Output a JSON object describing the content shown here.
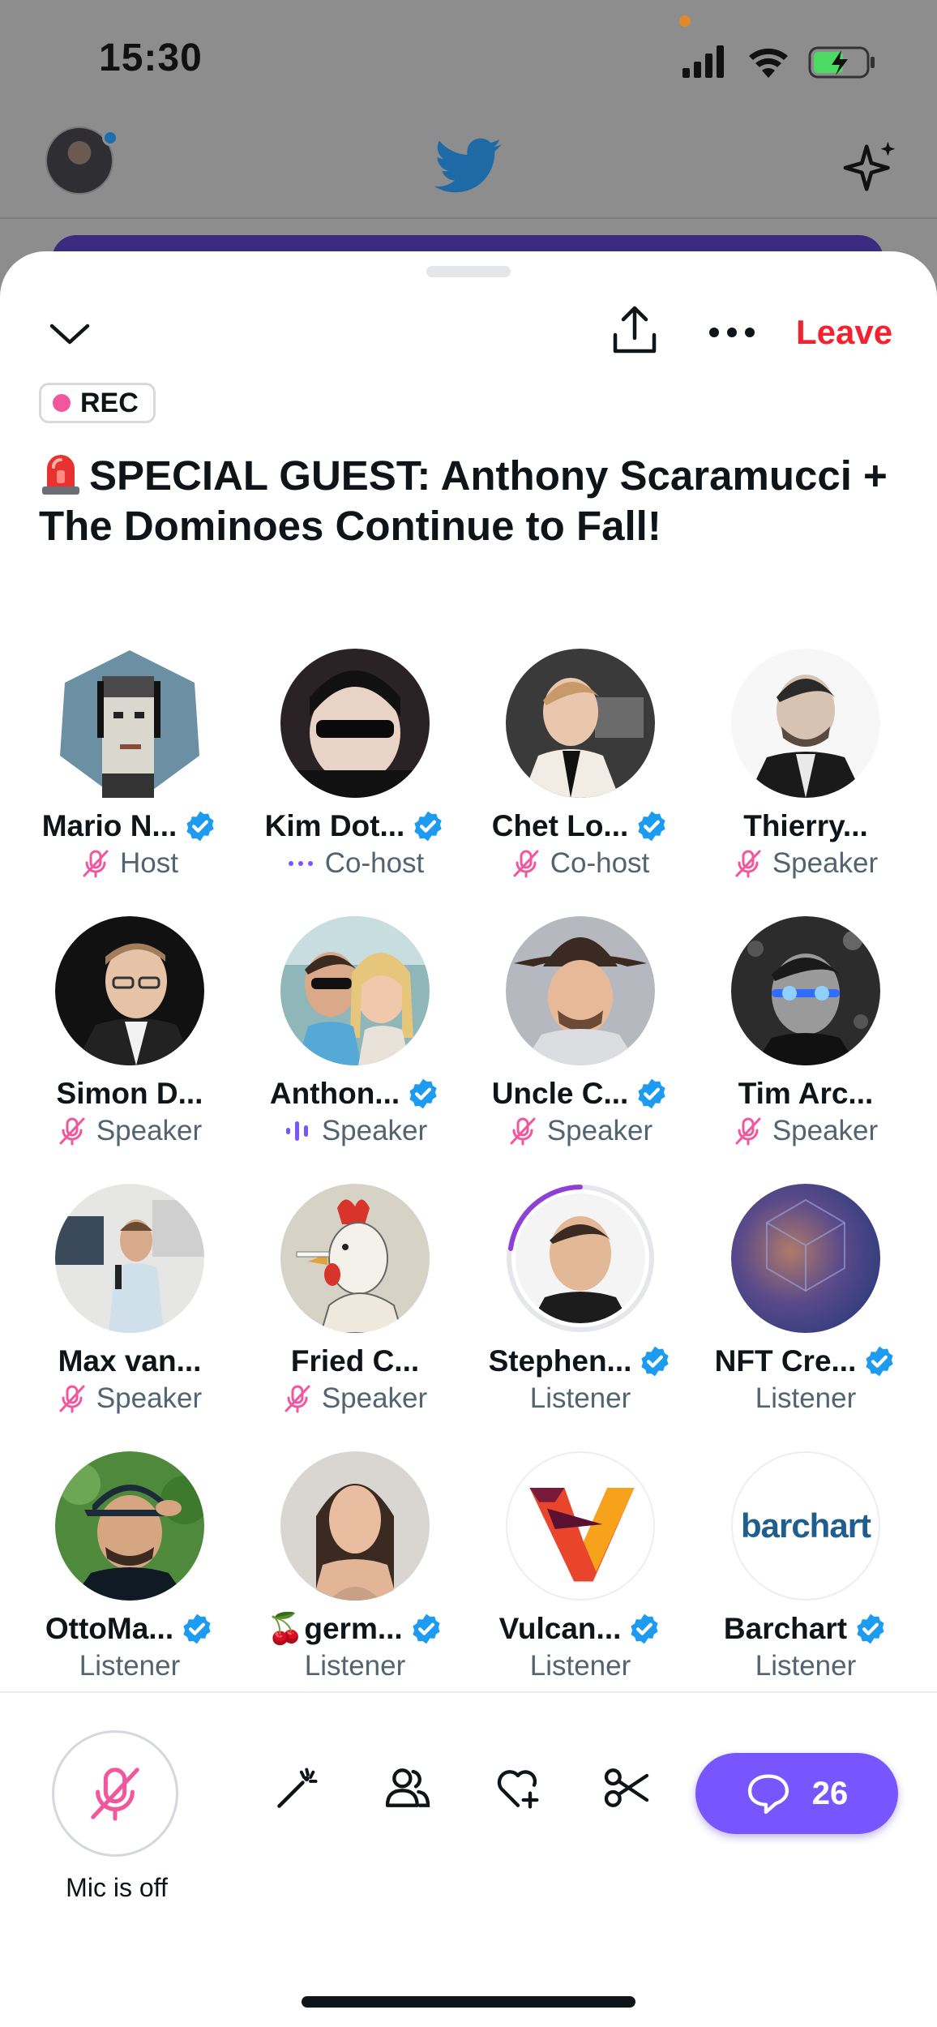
{
  "status_bar": {
    "time": "15:30"
  },
  "space": {
    "leave_label": "Leave",
    "rec_label": "REC",
    "title": "SPECIAL GUEST: Anthony Scaramucci + The Dominoes Continue to Fall!"
  },
  "participants": [
    {
      "name": "Mario N...",
      "role": "Host",
      "verified": true,
      "role_icon": "mic-muted-icon"
    },
    {
      "name": "Kim Dot...",
      "role": "Co-host",
      "verified": true,
      "role_icon": "dots-icon"
    },
    {
      "name": "Chet Lo...",
      "role": "Co-host",
      "verified": true,
      "role_icon": "mic-muted-icon"
    },
    {
      "name": "Thierry...",
      "role": "Speaker",
      "verified": false,
      "role_icon": "mic-muted-icon"
    },
    {
      "name": "Simon D...",
      "role": "Speaker",
      "verified": false,
      "role_icon": "mic-muted-icon"
    },
    {
      "name": "Anthon...",
      "role": "Speaker",
      "verified": true,
      "role_icon": "speaking-bars-icon"
    },
    {
      "name": "Uncle C...",
      "role": "Speaker",
      "verified": true,
      "role_icon": "mic-muted-icon"
    },
    {
      "name": "Tim Arc...",
      "role": "Speaker",
      "verified": false,
      "role_icon": "mic-muted-icon"
    },
    {
      "name": "Max van...",
      "role": "Speaker",
      "verified": false,
      "role_icon": "mic-muted-icon"
    },
    {
      "name": "Fried C...",
      "role": "Speaker",
      "verified": false,
      "role_icon": "mic-muted-icon"
    },
    {
      "name": "Stephen...",
      "role": "Listener",
      "verified": true,
      "role_icon": ""
    },
    {
      "name": "NFT Cre...",
      "role": "Listener",
      "verified": true,
      "role_icon": ""
    },
    {
      "name": "OttoMa...",
      "role": "Listener",
      "verified": true,
      "role_icon": ""
    },
    {
      "name": "🍒germ...",
      "role": "Listener",
      "verified": true,
      "role_icon": ""
    },
    {
      "name": "Vulcan...",
      "role": "Listener",
      "verified": true,
      "role_icon": ""
    },
    {
      "name": "Barchart",
      "role": "Listener",
      "verified": true,
      "role_icon": "",
      "logo_text": "barchart"
    }
  ],
  "bottom_bar": {
    "mic_label": "Mic is off",
    "comments_count": "26"
  },
  "colors": {
    "accent_red": "#f4212e",
    "muted_pink": "#f2579e",
    "verified_blue": "#1d9bf0",
    "comments_purple": "#7856ff",
    "twitter_blue": "#1d9bf0"
  }
}
